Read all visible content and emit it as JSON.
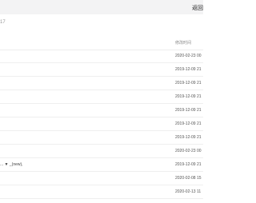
{
  "topbar": {
    "right_text": "返回"
  },
  "breadcrumb": {
    "text": "17"
  },
  "table": {
    "modified_header": "修改时间",
    "rows": [
      {
        "name": "",
        "modified": "2020-02-23 00"
      },
      {
        "name": "",
        "modified": "2019-12-09 21"
      },
      {
        "name": "",
        "modified": "2019-12-09 21"
      },
      {
        "name": "",
        "modified": "2019-12-09 21"
      },
      {
        "name": "",
        "modified": "2019-12-09 21"
      },
      {
        "name": "",
        "modified": "2019-12-09 21"
      },
      {
        "name": "",
        "modified": "2019-12-09 21"
      },
      {
        "name": "",
        "modified": "2020-02-23 00"
      },
      {
        "name": "...  ▼ _(new),",
        "modified": "2019-12-09 21"
      },
      {
        "name": "",
        "modified": "2020-02-08 15"
      },
      {
        "name": "",
        "modified": "2020-02-13 11"
      }
    ]
  }
}
